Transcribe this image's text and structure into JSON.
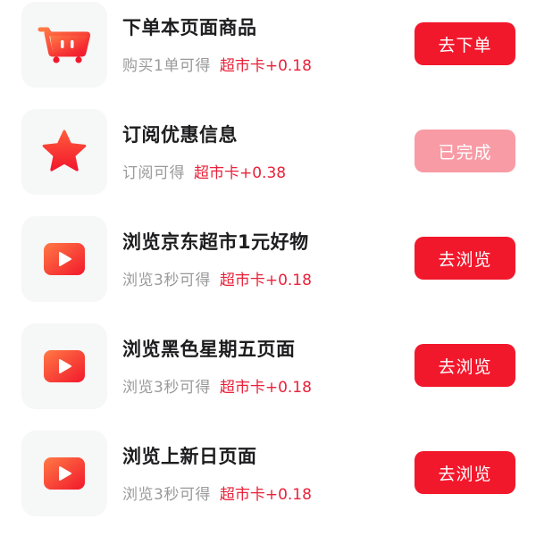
{
  "tasks": [
    {
      "icon": "shopping-cart-icon",
      "title": "下单本页面商品",
      "condition": "购买1单可得",
      "reward": "超市卡+0.18",
      "button_label": "去下单",
      "status": "pending"
    },
    {
      "icon": "star-icon",
      "title": "订阅优惠信息",
      "condition": "订阅可得",
      "reward": "超市卡+0.38",
      "button_label": "已完成",
      "status": "completed"
    },
    {
      "icon": "play-video-icon",
      "title": "浏览京东超市1元好物",
      "condition": "浏览3秒可得",
      "reward": "超市卡+0.18",
      "button_label": "去浏览",
      "status": "pending"
    },
    {
      "icon": "play-video-icon",
      "title": "浏览黑色星期五页面",
      "condition": "浏览3秒可得",
      "reward": "超市卡+0.18",
      "button_label": "去浏览",
      "status": "pending"
    },
    {
      "icon": "play-video-icon",
      "title": "浏览上新日页面",
      "condition": "浏览3秒可得",
      "reward": "超市卡+0.18",
      "button_label": "去浏览",
      "status": "pending"
    }
  ],
  "colors": {
    "accent_red": "#f2182c",
    "done_pink": "#f89ba5",
    "reward_red": "#e8223a",
    "muted_text": "#9a9a9a",
    "title_text": "#1d1d1f",
    "icon_tile_bg": "#f6f7f7"
  }
}
